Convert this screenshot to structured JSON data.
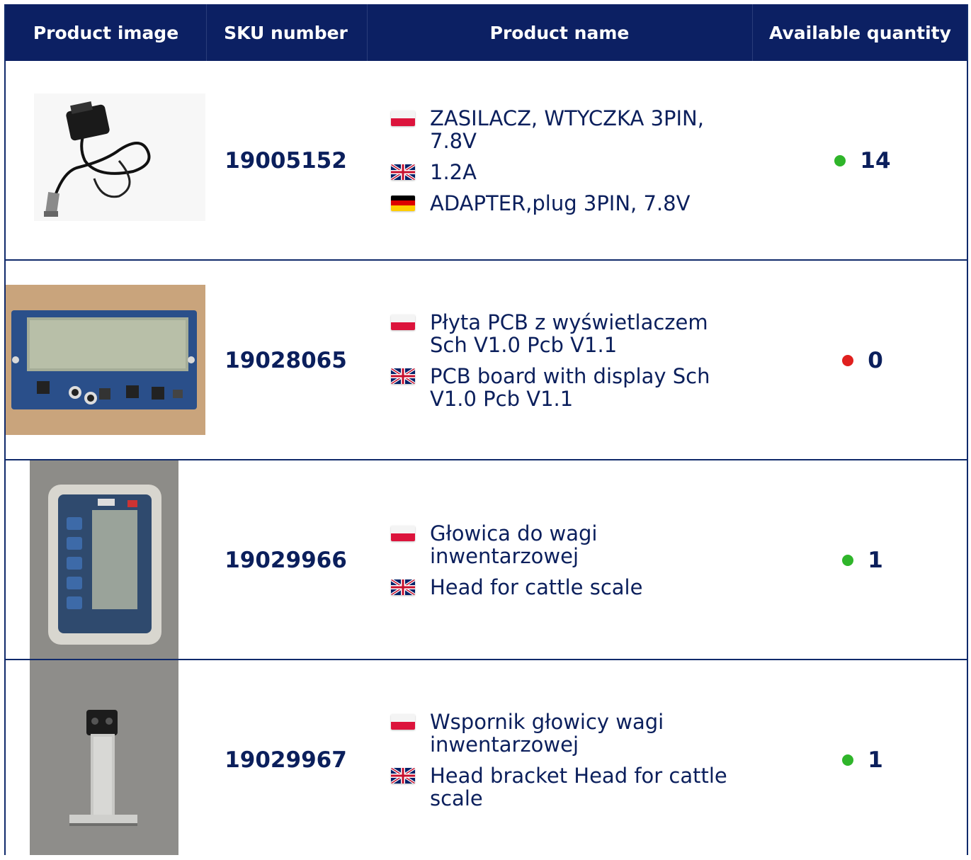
{
  "colors": {
    "header_bg": "#0c2063",
    "text": "#0b1f5c",
    "in_stock": "#2fb52a",
    "out_of_stock": "#e0201e"
  },
  "header": {
    "image_col": "Product image",
    "sku_col": "SKU number",
    "name_col": "Product name",
    "qty_col": "Available quantity"
  },
  "rows": [
    {
      "sku": "19005152",
      "names": [
        {
          "lang": "pl",
          "flag_icon": "poland-flag-icon",
          "text": "ZASILACZ, WTYCZKA 3PIN, 7.8V"
        },
        {
          "lang": "en",
          "flag_icon": "uk-flag-icon",
          "text": "1.2A"
        },
        {
          "lang": "de",
          "flag_icon": "germany-flag-icon",
          "text": "ADAPTER,plug 3PIN, 7.8V"
        }
      ],
      "quantity": "14",
      "stock_status": "in-stock",
      "image_icon": "power-adapter-photo"
    },
    {
      "sku": "19028065",
      "names": [
        {
          "lang": "pl",
          "flag_icon": "poland-flag-icon",
          "text": "Płyta PCB z wyświetlaczem Sch V1.0 Pcb V1.1"
        },
        {
          "lang": "en",
          "flag_icon": "uk-flag-icon",
          "text": "PCB board with display Sch V1.0 Pcb V1.1"
        }
      ],
      "quantity": "0",
      "stock_status": "out-of-stock",
      "image_icon": "pcb-board-photo"
    },
    {
      "sku": "19029966",
      "names": [
        {
          "lang": "pl",
          "flag_icon": "poland-flag-icon",
          "text": "Głowica do wagi inwentarzowej"
        },
        {
          "lang": "en",
          "flag_icon": "uk-flag-icon",
          "text": "Head for cattle scale"
        }
      ],
      "quantity": "1",
      "stock_status": "in-stock",
      "image_icon": "scale-head-photo"
    },
    {
      "sku": "19029967",
      "names": [
        {
          "lang": "pl",
          "flag_icon": "poland-flag-icon",
          "text": "Wspornik głowicy wagi inwentarzowej"
        },
        {
          "lang": "en",
          "flag_icon": "uk-flag-icon",
          "text": "Head bracket Head for cattle scale"
        }
      ],
      "quantity": "1",
      "stock_status": "in-stock",
      "image_icon": "head-bracket-photo"
    }
  ]
}
